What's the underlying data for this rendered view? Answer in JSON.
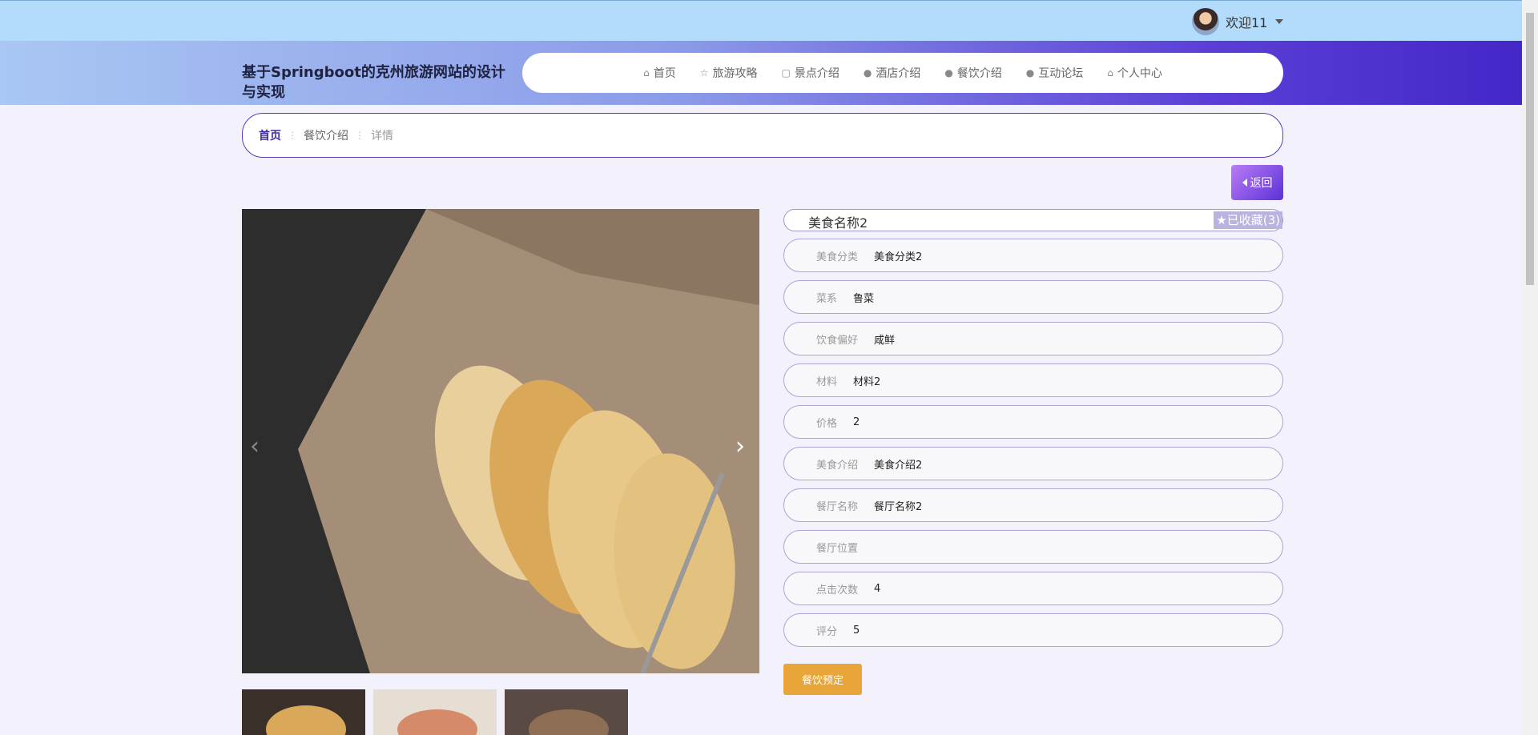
{
  "topbar": {
    "welcome": "欢迎11"
  },
  "header": {
    "site_title": "基于Springboot的克州旅游网站的设计与实现"
  },
  "nav": {
    "items": [
      {
        "icon": "home-icon",
        "label": "首页"
      },
      {
        "icon": "star-icon",
        "label": "旅游攻略"
      },
      {
        "icon": "bag-icon",
        "label": "景点介绍"
      },
      {
        "icon": "info-icon",
        "label": "酒店介绍"
      },
      {
        "icon": "question-icon",
        "label": "餐饮介绍"
      },
      {
        "icon": "info-icon",
        "label": "互动论坛"
      },
      {
        "icon": "home-icon",
        "label": "个人中心"
      }
    ]
  },
  "breadcrumb": {
    "home": "首页",
    "section": "餐饮介绍",
    "current": "详情"
  },
  "back_button": "返回",
  "detail": {
    "name": "美食名称2",
    "favorite": "已收藏(3)",
    "fields": [
      {
        "label": "美食分类",
        "value": "美食分类2"
      },
      {
        "label": "菜系",
        "value": "鲁菜"
      },
      {
        "label": "饮食偏好",
        "value": "咸鲜"
      },
      {
        "label": "材料",
        "value": "材料2"
      },
      {
        "label": "价格",
        "value": "2"
      },
      {
        "label": "美食介绍",
        "value": "美食介绍2"
      },
      {
        "label": "餐厅名称",
        "value": "餐厅名称2"
      },
      {
        "label": "餐厅位置",
        "value": ""
      },
      {
        "label": "点击次数",
        "value": "4"
      },
      {
        "label": "评分",
        "value": "5"
      }
    ]
  },
  "order_button": "餐饮预定",
  "colors": {
    "accent": "#5c31d8",
    "order": "#e8a63a",
    "topbar": "#b3dbfb"
  }
}
